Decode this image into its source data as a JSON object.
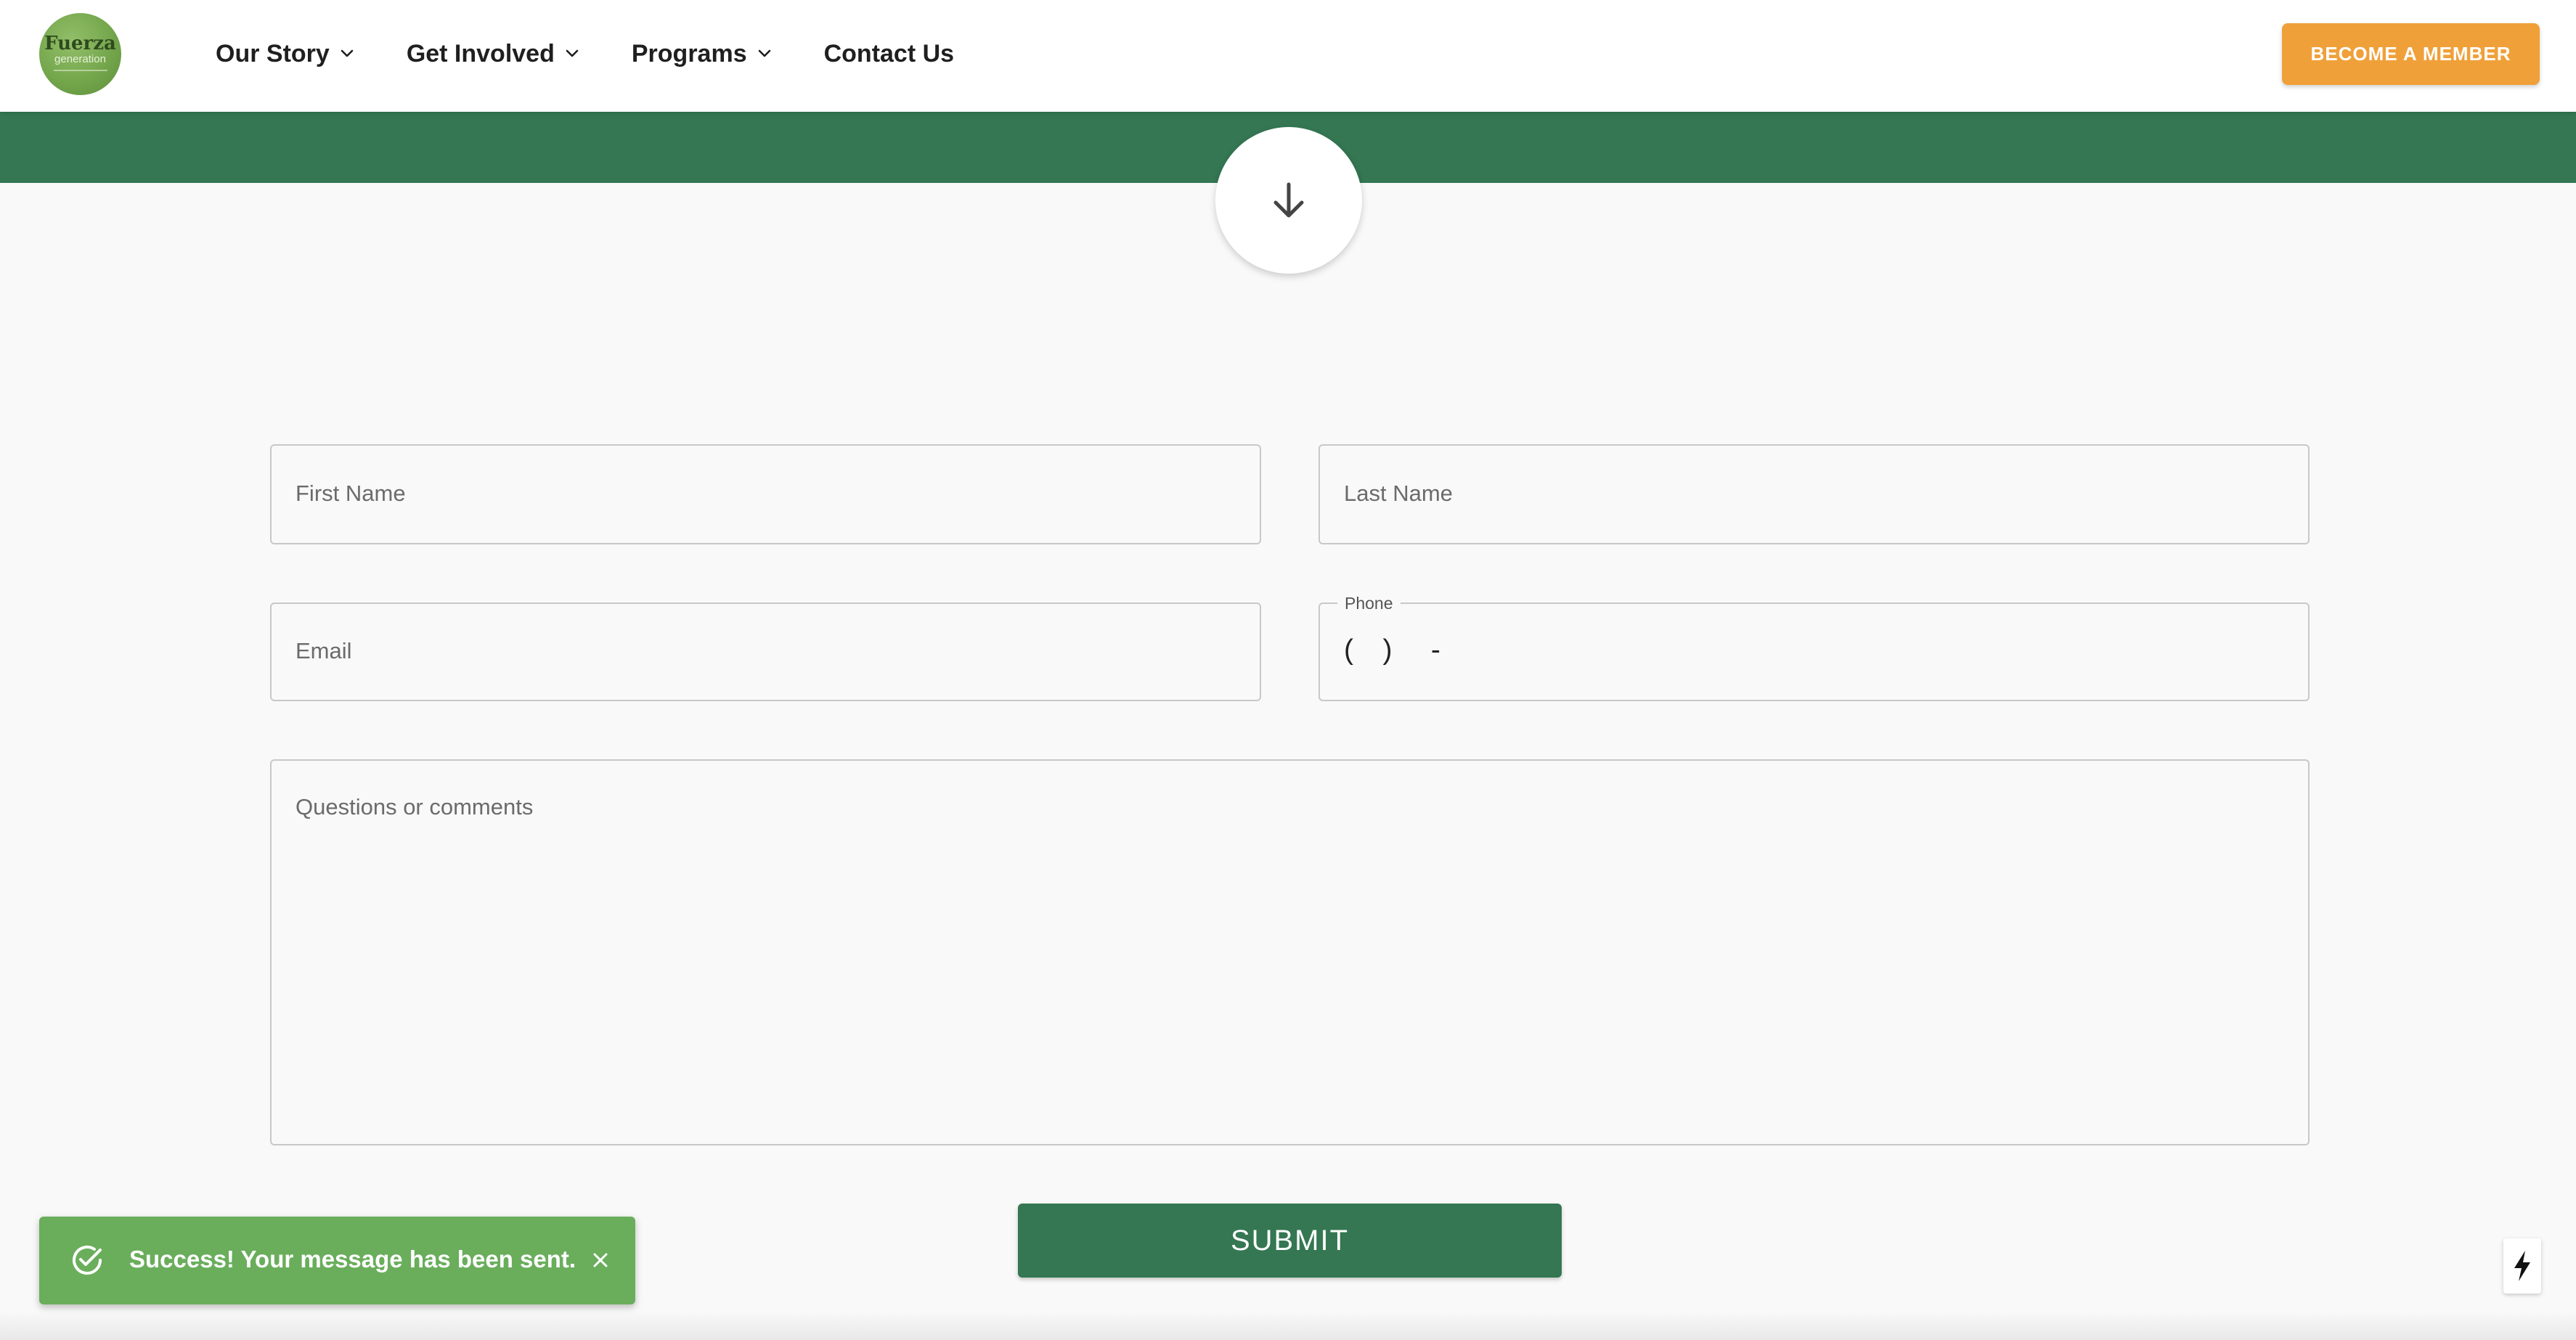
{
  "header": {
    "logo": {
      "main_text": "Fuerza",
      "sub_text": "generation"
    },
    "nav": [
      {
        "label": "Our Story",
        "has_dropdown": true
      },
      {
        "label": "Get Involved",
        "has_dropdown": true
      },
      {
        "label": "Programs",
        "has_dropdown": true
      },
      {
        "label": "Contact Us",
        "has_dropdown": false
      }
    ],
    "cta_label": "BECOME A MEMBER"
  },
  "scroll_button": {
    "icon": "arrow-down-icon"
  },
  "form": {
    "first_name": {
      "placeholder": "First Name",
      "value": ""
    },
    "last_name": {
      "placeholder": "Last Name",
      "value": ""
    },
    "email": {
      "placeholder": "Email",
      "value": ""
    },
    "phone": {
      "label": "Phone",
      "mask": "(   )    -"
    },
    "comments": {
      "placeholder": "Questions or comments",
      "value": ""
    },
    "submit_label": "SUBMIT"
  },
  "toast": {
    "message": "Success! Your message has been sent.",
    "icon": "check-circle-icon",
    "close_icon": "close-icon"
  },
  "floating_button": {
    "icon": "lightning-bolt-icon"
  },
  "colors": {
    "brand_green": "#347752",
    "accent_orange": "#f0a039",
    "toast_green": "#6aae5c",
    "page_background": "#f9f9f9"
  }
}
